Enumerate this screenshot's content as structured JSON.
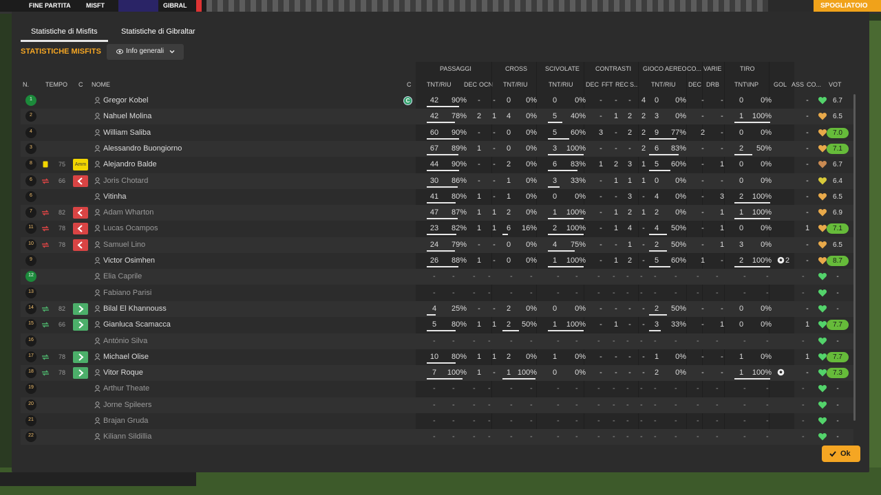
{
  "topbar": {
    "left_label": "FINE PARTITA",
    "team_a": "MISFT",
    "team_b": "GIBRAL",
    "right_button": "SPOGLIATOIO"
  },
  "tabs": [
    "Statistiche di Misfits",
    "Statistiche di Gibraltar"
  ],
  "section_title": "STATISTICHE MISFITS",
  "view_select": "Info generali",
  "group_headers": {
    "passaggi": "PASSAGGI",
    "cross": "CROSS",
    "scivolate": "SCIVOLATE",
    "contrasti": "CONTRASTI",
    "gioco_aereo": "GIOCO AEREO",
    "co": "CO...",
    "varie": "VARIE",
    "tiro": "TIRO"
  },
  "columns": {
    "n": "N.",
    "tempo": "TEMPO",
    "c": "C",
    "nome": "NOME",
    "c2": "C",
    "pas_tnt": "TNT/RIU",
    "pas_dec": "DEC",
    "pas_ocn": "OCN",
    "cross_tnt": "TNT/RIU",
    "sciv_tnt": "TNT/RIU",
    "con_dec": "DEC",
    "con_fft": "FFT",
    "con_rec": "REC",
    "con_s": "S...",
    "aer_tnt": "TNT/RIU",
    "co_dec": "DEC",
    "var_drb": "DRB",
    "tiro_tnt": "TNT\\INP",
    "gol": "GOL",
    "ass": "ASS",
    "cond": "CO...",
    "vot": "VOT"
  },
  "captain_badge": "C",
  "players": [
    {
      "n": "1",
      "gk": true,
      "name": "Gregor Kobel",
      "dim": false,
      "badge": "",
      "min": "",
      "captain": true,
      "pas": [
        "42",
        "90%"
      ],
      "pf": 0.9,
      "pdec": "-",
      "pocn": "-",
      "cr": [
        "0",
        "0%"
      ],
      "cf": 0,
      "sc": [
        "0",
        "0%"
      ],
      "sf": 0,
      "cdec": "-",
      "cfft": "-",
      "crec": "-",
      "cs": "4",
      "ae": [
        "0",
        "0%"
      ],
      "af": 0,
      "codec": "-",
      "drb": "-",
      "ti": [
        "0",
        "0%"
      ],
      "tf": 0,
      "gol": "",
      "ass": "-",
      "vot": "6.7",
      "hi": false,
      "heart": "#53d36b"
    },
    {
      "n": "2",
      "gk": false,
      "name": "Nahuel Molina",
      "dim": false,
      "badge": "",
      "min": "",
      "pas": [
        "42",
        "78%"
      ],
      "pf": 0.78,
      "pdec": "2",
      "pocn": "1",
      "cr": [
        "4",
        "0%"
      ],
      "cf": 0,
      "sc": [
        "5",
        "40%"
      ],
      "sf": 0.4,
      "cdec": "-",
      "cfft": "1",
      "crec": "2",
      "cs": "2",
      "ae": [
        "3",
        "0%"
      ],
      "af": 0,
      "codec": "-",
      "drb": "-",
      "ti": [
        "1",
        "100%"
      ],
      "tf": 1,
      "gol": "",
      "ass": "-",
      "vot": "6.5",
      "hi": false,
      "heart": "#e8a94a"
    },
    {
      "n": "4",
      "gk": false,
      "name": "William Saliba",
      "dim": false,
      "badge": "",
      "min": "",
      "pas": [
        "60",
        "90%"
      ],
      "pf": 0.9,
      "pdec": "-",
      "pocn": "-",
      "cr": [
        "0",
        "0%"
      ],
      "cf": 0,
      "sc": [
        "5",
        "60%"
      ],
      "sf": 0.6,
      "cdec": "3",
      "cfft": "-",
      "crec": "2",
      "cs": "2",
      "ae": [
        "9",
        "77%"
      ],
      "af": 0.77,
      "codec": "2",
      "drb": "-",
      "ti": [
        "0",
        "0%"
      ],
      "tf": 0,
      "gol": "",
      "ass": "-",
      "vot": "7.0",
      "hi": true,
      "heart": "#e8a94a"
    },
    {
      "n": "3",
      "gk": false,
      "name": "Alessandro Buongiorno",
      "dim": false,
      "badge": "",
      "min": "",
      "pas": [
        "67",
        "89%"
      ],
      "pf": 0.89,
      "pdec": "1",
      "pocn": "-",
      "cr": [
        "0",
        "0%"
      ],
      "cf": 0,
      "sc": [
        "3",
        "100%"
      ],
      "sf": 1,
      "cdec": "-",
      "cfft": "-",
      "crec": "-",
      "cs": "2",
      "ae": [
        "6",
        "83%"
      ],
      "af": 0.83,
      "codec": "-",
      "drb": "-",
      "ti": [
        "2",
        "50%"
      ],
      "tf": 0.5,
      "gol": "",
      "ass": "-",
      "vot": "7.1",
      "hi": true,
      "heart": "#e8a94a"
    },
    {
      "n": "8",
      "gk": false,
      "name": "Alejandro Balde",
      "dim": false,
      "badge": "yc",
      "badge_text": "Amm",
      "min": "75",
      "card": true,
      "pas": [
        "44",
        "90%"
      ],
      "pf": 0.9,
      "pdec": "-",
      "pocn": "-",
      "cr": [
        "2",
        "0%"
      ],
      "cf": 0,
      "sc": [
        "6",
        "83%"
      ],
      "sf": 0.83,
      "cdec": "1",
      "cfft": "2",
      "crec": "3",
      "cs": "1",
      "ae": [
        "5",
        "60%"
      ],
      "af": 0.6,
      "codec": "-",
      "drb": "1",
      "ti": [
        "0",
        "0%"
      ],
      "tf": 0,
      "gol": "",
      "ass": "-",
      "vot": "6.7",
      "hi": false,
      "heart": "#c98a52"
    },
    {
      "n": "6",
      "gk": false,
      "name": "Joris Chotard",
      "dim": true,
      "badge": "out",
      "min": "66",
      "pas": [
        "30",
        "86%"
      ],
      "pf": 0.86,
      "pdec": "-",
      "pocn": "-",
      "cr": [
        "1",
        "0%"
      ],
      "cf": 0,
      "sc": [
        "3",
        "33%"
      ],
      "sf": 0.33,
      "cdec": "-",
      "cfft": "1",
      "crec": "1",
      "cs": "1",
      "ae": [
        "0",
        "0%"
      ],
      "af": 0,
      "codec": "-",
      "drb": "-",
      "ti": [
        "0",
        "0%"
      ],
      "tf": 0,
      "gol": "",
      "ass": "-",
      "vot": "6.4",
      "hi": false,
      "heart": "#d8c93a"
    },
    {
      "n": "6",
      "gk": false,
      "name": "Vitinha",
      "dim": false,
      "badge": "",
      "min": "",
      "pas": [
        "41",
        "80%"
      ],
      "pf": 0.8,
      "pdec": "1",
      "pocn": "-",
      "cr": [
        "1",
        "0%"
      ],
      "cf": 0,
      "sc": [
        "0",
        "0%"
      ],
      "sf": 0,
      "cdec": "-",
      "cfft": "-",
      "crec": "3",
      "cs": "-",
      "ae": [
        "4",
        "0%"
      ],
      "af": 0,
      "codec": "-",
      "drb": "3",
      "ti": [
        "2",
        "100%"
      ],
      "tf": 1,
      "gol": "",
      "ass": "-",
      "vot": "6.5",
      "hi": false,
      "heart": "#e8a94a"
    },
    {
      "n": "7",
      "gk": false,
      "name": "Adam Wharton",
      "dim": true,
      "badge": "out",
      "min": "82",
      "pas": [
        "47",
        "87%"
      ],
      "pf": 0.87,
      "pdec": "1",
      "pocn": "1",
      "cr": [
        "2",
        "0%"
      ],
      "cf": 0,
      "sc": [
        "1",
        "100%"
      ],
      "sf": 1,
      "cdec": "-",
      "cfft": "1",
      "crec": "2",
      "cs": "1",
      "ae": [
        "2",
        "0%"
      ],
      "af": 0,
      "codec": "-",
      "drb": "1",
      "ti": [
        "1",
        "100%"
      ],
      "tf": 1,
      "gol": "",
      "ass": "-",
      "vot": "6.9",
      "hi": false,
      "heart": "#e8a94a"
    },
    {
      "n": "11",
      "gk": false,
      "name": "Lucas Ocampos",
      "dim": true,
      "badge": "out",
      "min": "78",
      "pas": [
        "23",
        "82%"
      ],
      "pf": 0.82,
      "pdec": "1",
      "pocn": "1",
      "cr": [
        "6",
        "16%"
      ],
      "cf": 0.16,
      "sc": [
        "2",
        "100%"
      ],
      "sf": 1,
      "cdec": "-",
      "cfft": "1",
      "crec": "4",
      "cs": "-",
      "ae": [
        "4",
        "50%"
      ],
      "af": 0.5,
      "codec": "-",
      "drb": "1",
      "ti": [
        "0",
        "0%"
      ],
      "tf": 0,
      "gol": "",
      "ass": "1",
      "vot": "7.1",
      "hi": true,
      "heart": "#e8a94a"
    },
    {
      "n": "10",
      "gk": false,
      "name": "Samuel Lino",
      "dim": true,
      "badge": "out",
      "min": "78",
      "pas": [
        "24",
        "79%"
      ],
      "pf": 0.79,
      "pdec": "-",
      "pocn": "-",
      "cr": [
        "0",
        "0%"
      ],
      "cf": 0,
      "sc": [
        "4",
        "75%"
      ],
      "sf": 0.75,
      "cdec": "-",
      "cfft": "-",
      "crec": "1",
      "cs": "-",
      "ae": [
        "2",
        "50%"
      ],
      "af": 0.5,
      "codec": "-",
      "drb": "1",
      "ti": [
        "3",
        "0%"
      ],
      "tf": 0,
      "gol": "",
      "ass": "-",
      "vot": "6.5",
      "hi": false,
      "heart": "#e8a94a"
    },
    {
      "n": "9",
      "gk": false,
      "name": "Victor Osimhen",
      "dim": false,
      "badge": "",
      "min": "",
      "pas": [
        "26",
        "88%"
      ],
      "pf": 0.88,
      "pdec": "1",
      "pocn": "-",
      "cr": [
        "0",
        "0%"
      ],
      "cf": 0,
      "sc": [
        "1",
        "100%"
      ],
      "sf": 1,
      "cdec": "-",
      "cfft": "1",
      "crec": "2",
      "cs": "-",
      "ae": [
        "5",
        "60%"
      ],
      "af": 0.6,
      "codec": "1",
      "drb": "-",
      "ti": [
        "2",
        "100%"
      ],
      "tf": 1,
      "gol": "2",
      "goal_icon": true,
      "ass": "-",
      "vot": "8.7",
      "hi": true,
      "heart": "#e8a94a"
    },
    {
      "n": "12",
      "gk": true,
      "name": "Elia Caprile",
      "dim": true,
      "empty": true,
      "heart": "#53d36b",
      "vot": "-"
    },
    {
      "n": "13",
      "gk": false,
      "name": "Fabiano Parisi",
      "dim": true,
      "empty": true,
      "heart": "#53d36b",
      "vot": "-"
    },
    {
      "n": "14",
      "gk": false,
      "name": "Bilal El Khannouss",
      "dim": false,
      "badge": "in",
      "min": "82",
      "pas": [
        "4",
        "25%"
      ],
      "pf": 0.25,
      "pdec": "-",
      "pocn": "-",
      "cr": [
        "2",
        "0%"
      ],
      "cf": 0,
      "sc": [
        "0",
        "0%"
      ],
      "sf": 0,
      "cdec": "-",
      "cfft": "-",
      "crec": "-",
      "cs": "-",
      "ae": [
        "2",
        "50%"
      ],
      "af": 0.5,
      "codec": "-",
      "drb": "-",
      "ti": [
        "0",
        "0%"
      ],
      "tf": 0,
      "gol": "",
      "ass": "-",
      "vot": "-",
      "hi": false,
      "heart": "#53d36b"
    },
    {
      "n": "15",
      "gk": false,
      "name": "Gianluca Scamacca",
      "dim": false,
      "badge": "in",
      "min": "66",
      "pas": [
        "5",
        "80%"
      ],
      "pf": 0.8,
      "pdec": "1",
      "pocn": "1",
      "cr": [
        "2",
        "50%"
      ],
      "cf": 0.5,
      "sc": [
        "1",
        "100%"
      ],
      "sf": 1,
      "cdec": "-",
      "cfft": "1",
      "crec": "-",
      "cs": "-",
      "ae": [
        "3",
        "33%"
      ],
      "af": 0.33,
      "codec": "-",
      "drb": "1",
      "ti": [
        "0",
        "0%"
      ],
      "tf": 0,
      "gol": "",
      "ass": "1",
      "vot": "7.7",
      "hi": true,
      "heart": "#53d36b"
    },
    {
      "n": "16",
      "gk": false,
      "name": "António Silva",
      "dim": true,
      "empty": true,
      "heart": "#53d36b",
      "vot": "-"
    },
    {
      "n": "17",
      "gk": false,
      "name": "Michael Olise",
      "dim": false,
      "badge": "in",
      "min": "78",
      "pas": [
        "10",
        "80%"
      ],
      "pf": 0.8,
      "pdec": "1",
      "pocn": "1",
      "cr": [
        "2",
        "0%"
      ],
      "cf": 0,
      "sc": [
        "1",
        "0%"
      ],
      "sf": 0,
      "cdec": "-",
      "cfft": "-",
      "crec": "-",
      "cs": "-",
      "ae": [
        "1",
        "0%"
      ],
      "af": 0,
      "codec": "-",
      "drb": "-",
      "ti": [
        "1",
        "0%"
      ],
      "tf": 0,
      "gol": "",
      "ass": "1",
      "vot": "7.7",
      "hi": true,
      "heart": "#53d36b"
    },
    {
      "n": "18",
      "gk": false,
      "name": "Vitor Roque",
      "dim": false,
      "badge": "in",
      "min": "78",
      "pas": [
        "7",
        "100%"
      ],
      "pf": 1,
      "pdec": "1",
      "pocn": "-",
      "cr": [
        "1",
        "100%"
      ],
      "cf": 1,
      "sc": [
        "0",
        "0%"
      ],
      "sf": 0,
      "cdec": "-",
      "cfft": "-",
      "crec": "-",
      "cs": "-",
      "ae": [
        "2",
        "0%"
      ],
      "af": 0,
      "codec": "-",
      "drb": "-",
      "ti": [
        "1",
        "100%"
      ],
      "tf": 1,
      "gol": "",
      "goal_icon": true,
      "ass": "-",
      "vot": "7.3",
      "hi": true,
      "heart": "#53d36b"
    },
    {
      "n": "19",
      "gk": false,
      "name": "Arthur Theate",
      "dim": true,
      "empty": true,
      "heart": "#53d36b",
      "vot": "-"
    },
    {
      "n": "20",
      "gk": false,
      "name": "Jorne Spileers",
      "dim": true,
      "empty": true,
      "heart": "#53d36b",
      "vot": "-"
    },
    {
      "n": "21",
      "gk": false,
      "name": "Brajan Gruda",
      "dim": true,
      "empty": true,
      "heart": "#53d36b",
      "vot": "-"
    },
    {
      "n": "22",
      "gk": false,
      "name": "Kiliann Sildillia",
      "dim": true,
      "empty": true,
      "heart": "#53d36b",
      "vot": "-"
    }
  ],
  "ok_button": "Ok"
}
